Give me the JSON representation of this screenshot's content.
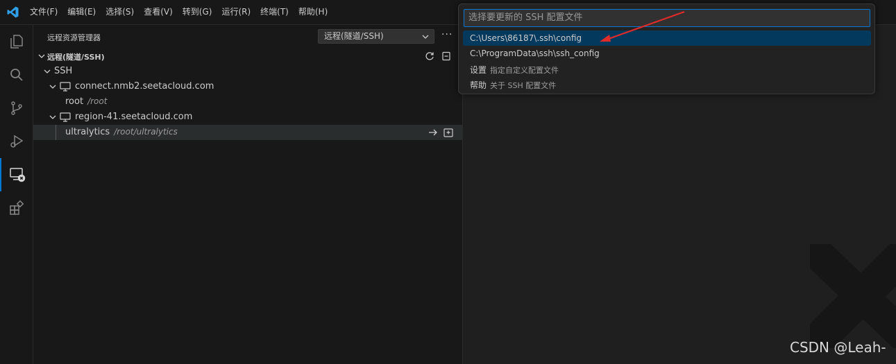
{
  "menu": [
    "文件(F)",
    "编辑(E)",
    "选择(S)",
    "查看(V)",
    "转到(G)",
    "运行(R)",
    "终端(T)",
    "帮助(H)"
  ],
  "activity_bar": [
    "explorer-icon",
    "search-icon",
    "source-control-icon",
    "run-debug-icon",
    "remote-explorer-icon",
    "extensions-icon"
  ],
  "sidebar": {
    "title": "远程资源管理器",
    "dropdown_value": "远程(隧道/SSH)",
    "more": "···",
    "section_label": "远程(隧道/SSH)",
    "tree": {
      "group": "SSH",
      "hosts": [
        {
          "name": "connect.nmb2.seetacloud.com",
          "folders": [
            {
              "name": "root",
              "path": "/root"
            }
          ]
        },
        {
          "name": "region-41.seetacloud.com",
          "folders": [
            {
              "name": "ultralytics",
              "path": "/root/ultralytics"
            }
          ]
        }
      ]
    }
  },
  "quick_pick": {
    "placeholder": "选择要更新的 SSH 配置文件",
    "items": [
      {
        "label": "C:\\Users\\86187\\.ssh\\config",
        "hint": ""
      },
      {
        "label": "C:\\ProgramData\\ssh\\ssh_config",
        "hint": ""
      },
      {
        "label": "设置",
        "hint": "指定自定义配置文件"
      },
      {
        "label": "帮助",
        "hint": "关于 SSH 配置文件"
      }
    ]
  },
  "watermark_text": "CSDN @Leah-",
  "colors": {
    "accent": "#0078d4",
    "focused_item": "#04395e",
    "annotation_arrow": "#e02b2b"
  }
}
